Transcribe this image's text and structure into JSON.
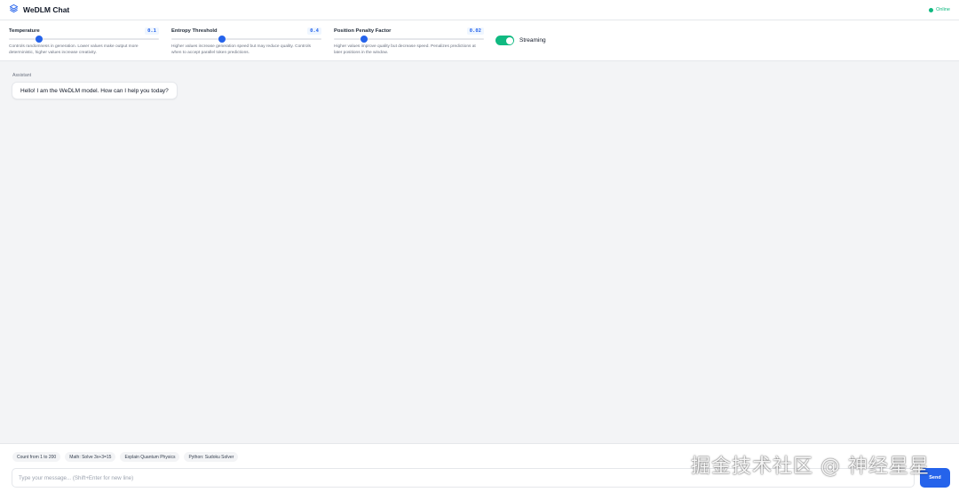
{
  "app": {
    "title": "WeDLM Chat",
    "status": "Online"
  },
  "controls": {
    "temperature": {
      "label": "Temperature",
      "value": "0.1",
      "fraction": 0.2,
      "description": "Controls randomness in generation. Lower values make output more deterministic, higher values increase creativity."
    },
    "entropy": {
      "label": "Entropy Threshold",
      "value": "0.4",
      "fraction": 0.34,
      "description": "Higher values increase generation speed but may reduce quality. Controls when to accept parallel token predictions."
    },
    "penalty": {
      "label": "Position Penalty Factor",
      "value": "0.02",
      "fraction": 0.2,
      "description": "Higher values improve quality but decrease speed. Penalizes predictions at later positions in the window."
    },
    "streaming": {
      "label": "Streaming",
      "on": true
    }
  },
  "chat": {
    "messages": [
      {
        "role": "Assistant",
        "text": "Hello! I am the WeDLM model. How can I help you today?"
      }
    ]
  },
  "suggestions": [
    "Count from 1 to 200",
    "Math: Solve 3x+3=15",
    "Explain Quantum Physics",
    "Python: Sudoku Solver"
  ],
  "composer": {
    "placeholder": "Type your message... (Shift+Enter for new line)",
    "send_label": "Send"
  },
  "watermark": "掘金技术社区 @ 神经星星",
  "colors": {
    "accent": "#2563eb",
    "online": "#10b981",
    "toggle": "#10b981"
  },
  "icons": {
    "logo": "layers-icon"
  }
}
